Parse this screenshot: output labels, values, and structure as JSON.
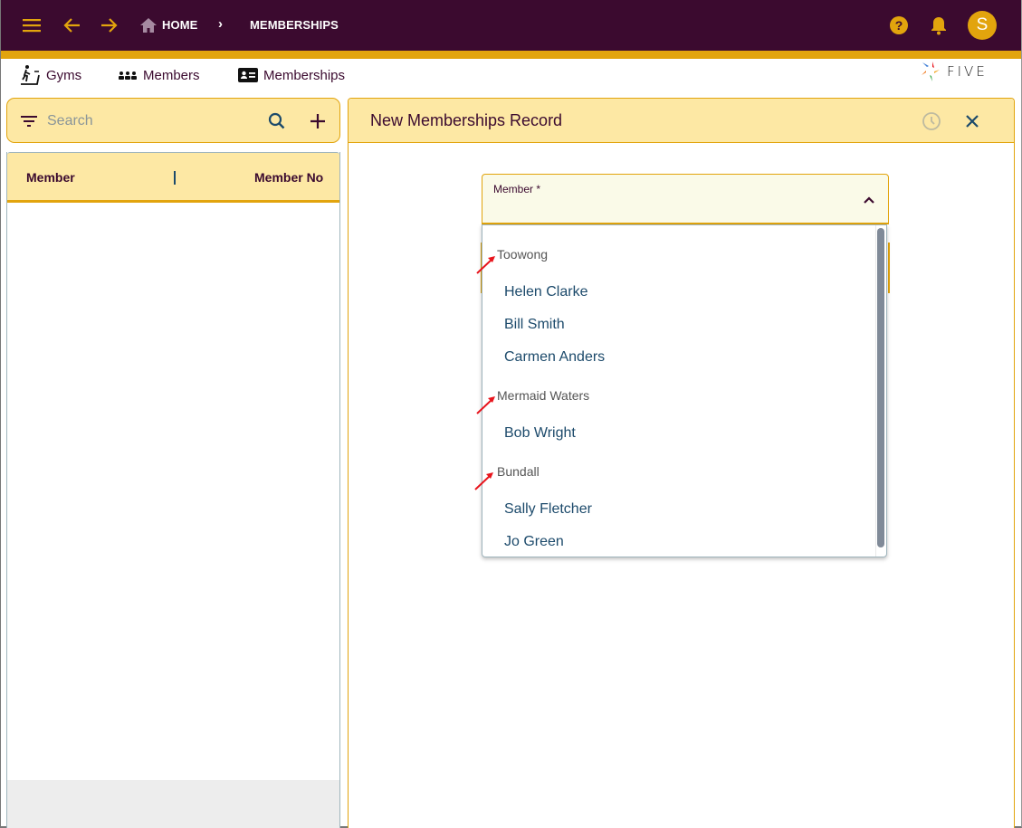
{
  "appbar": {
    "breadcrumb": [
      {
        "label": "HOME",
        "icon": "home-icon"
      },
      {
        "label": "MEMBERSHIPS"
      }
    ],
    "avatar_initial": "S",
    "icons": [
      "menu-icon",
      "back-arrow-icon",
      "forward-arrow-icon",
      "help-icon",
      "bell-icon"
    ]
  },
  "nav": {
    "items": [
      {
        "label": "Gyms",
        "icon": "treadmill-icon"
      },
      {
        "label": "Members",
        "icon": "people-icon"
      },
      {
        "label": "Memberships",
        "icon": "id-card-icon"
      }
    ],
    "logo_text": "FIVE"
  },
  "list": {
    "search_placeholder": "Search",
    "search_value": "",
    "columns": [
      "Member",
      "Member No"
    ],
    "rows": []
  },
  "form": {
    "title": "New Memberships Record",
    "member_field": {
      "label": "Member *",
      "value": ""
    },
    "dropdown": {
      "groups": [
        {
          "name": "Toowong",
          "items": [
            "Helen Clarke",
            "Bill Smith",
            "Carmen Anders"
          ]
        },
        {
          "name": "Mermaid Waters",
          "items": [
            "Bob Wright"
          ]
        },
        {
          "name": "Bundall",
          "items": [
            "Sally Fletcher",
            "Jo Green"
          ]
        }
      ]
    }
  },
  "colors": {
    "appbar": "#3b0a2f",
    "accent": "#e2a40d",
    "panel_header": "#fde8a4",
    "item_text": "#1c4a6b",
    "annotation_arrow": "#e8141c"
  }
}
